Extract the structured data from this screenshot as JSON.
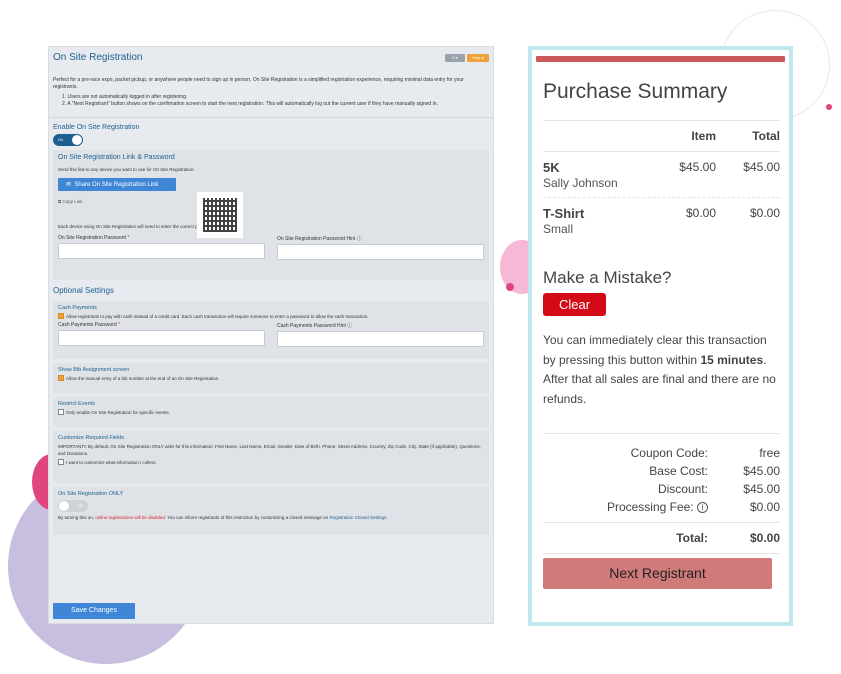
{
  "on_site": {
    "title": "On Site Registration",
    "badge_gray": "0 ▾",
    "badge_help": "Help ●",
    "desc_part1": "Perfect for a pre-race expo, packet pickup, or anywhere people need to sign up in person. On Site Registration is a simplified registration experience, requiring minimal data entry for your registrants.",
    "list": [
      "1. Users are not automatically logged in after registering.",
      "2. A \"Next Registrant\" button shows on the confirmation screen to start the next registration. This will automatically log out the current user if they have manually signed in."
    ],
    "enable_label": "Enable On Site Registration",
    "enable_toggle": "On",
    "link_box": {
      "title": "On Site Registration Link & Password",
      "send_text": "Send this link to any device you want to use for On Site Registration:",
      "share_button": "Share On Site Registration Link",
      "copy_link": "Copy Link",
      "device_note": "Each device using On Site Registration will need to enter the correct password.",
      "password_label": "On Site Registration Password",
      "required_mark": "*",
      "hint_label": "On Site Registration Password Hint ⓘ"
    },
    "optional_title": "Optional Settings",
    "cash": {
      "title": "Cash Payments",
      "check_text": "Allow registrants to pay with cash instead of a credit card. Each cash transaction will require someone to enter a password to allow the cash transaction.",
      "password_label": "Cash Payments Password",
      "required_mark": "*",
      "hint_label": "Cash Payments Password Hint ⓘ"
    },
    "bib": {
      "title": "Show Bib Assignment screen",
      "check_text": "Allow the manual entry of a bib number at the end of an On Site Registration."
    },
    "restrict": {
      "title": "Restrict Events",
      "check_text": "Only enable On Site Registration for specific events."
    },
    "customize": {
      "title": "Customize Required Fields",
      "important": "IMPORTANT!! By default, On Site Registration ONLY asks for this information: First Name, Last Name, Email, Gender, Date of Birth, Phone, Street Address, Country, Zip Code, City, State (if applicable), Questions, and Donations.",
      "check_text": "I want to customize what information I collect."
    },
    "only": {
      "title": "On Site Registration ONLY",
      "toggle": "Off",
      "note_pre": "By turning this on,",
      "note_red": "online registrations will be disabled.",
      "note_mid": "You can inform registrants of this restriction by customizing a closed message on",
      "note_link": "Registration Closed Settings."
    },
    "save_button": "Save Changes"
  },
  "purchase": {
    "title": "Purchase Summary",
    "col_item": "Item",
    "col_total": "Total",
    "rows": [
      {
        "name": "5K",
        "sub": "Sally Johnson",
        "item": "$45.00",
        "total": "$45.00"
      },
      {
        "name": "T-Shirt",
        "sub": "Small",
        "item": "$0.00",
        "total": "$0.00"
      }
    ],
    "mistake_title": "Make a Mistake?",
    "clear_button": "Clear",
    "mistake_text_1": "You can immediately clear this transaction by pressing this button within",
    "mistake_bold": "15 minutes",
    "mistake_text_2": ". After that all sales are final and there are no refunds.",
    "coupon_label": "Coupon Code:",
    "coupon_value": "free",
    "base_label": "Base Cost:",
    "base_value": "$45.00",
    "discount_label": "Discount:",
    "discount_value": "$45.00",
    "fee_label": "Processing Fee:",
    "fee_icon": "i",
    "fee_value": "$0.00",
    "total_label": "Total:",
    "total_value": "$0.00",
    "next_button": "Next Registrant"
  },
  "colors": {
    "accent_blue": "#3f87d6",
    "title_blue": "#1d5f8f",
    "clear_red": "#d30b16",
    "next_button": "#d07a7a",
    "frame_cyan": "#bfe7ef"
  }
}
